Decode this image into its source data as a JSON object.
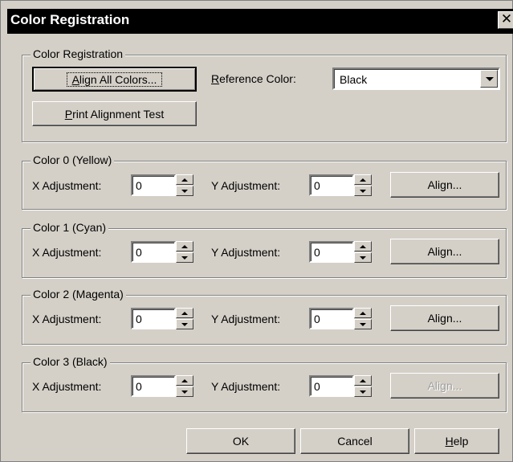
{
  "window": {
    "title": "Color Registration",
    "close": "✕"
  },
  "registration": {
    "group_label": "Color Registration",
    "align_all_prefix": "",
    "align_all_mnemonic": "A",
    "align_all_rest": "lign All Colors...",
    "reference_mnemonic": "R",
    "reference_rest": "eference Color:",
    "reference_value": "Black",
    "print_mnemonic": "P",
    "print_rest": "rint Alignment Test"
  },
  "colors": [
    {
      "group_label": "Color 0 (Yellow)",
      "x_label": "X Adjustment:",
      "x_value": "0",
      "y_label": "Y Adjustment:",
      "y_value": "0",
      "align_label": "Align...",
      "align_enabled": true
    },
    {
      "group_label": "Color 1 (Cyan)",
      "x_label": "X Adjustment:",
      "x_value": "0",
      "y_label": "Y Adjustment:",
      "y_value": "0",
      "align_label": "Align...",
      "align_enabled": true
    },
    {
      "group_label": "Color 2 (Magenta)",
      "x_label": "X Adjustment:",
      "x_value": "0",
      "y_label": "Y Adjustment:",
      "y_value": "0",
      "align_label": "Align...",
      "align_enabled": true
    },
    {
      "group_label": "Color 3 (Black)",
      "x_label": "X Adjustment:",
      "x_value": "0",
      "y_label": "Y Adjustment:",
      "y_value": "0",
      "align_label": "Align...",
      "align_enabled": false
    }
  ],
  "footer": {
    "ok": "OK",
    "cancel": "Cancel",
    "help_mnemonic": "H",
    "help_rest": "elp"
  }
}
